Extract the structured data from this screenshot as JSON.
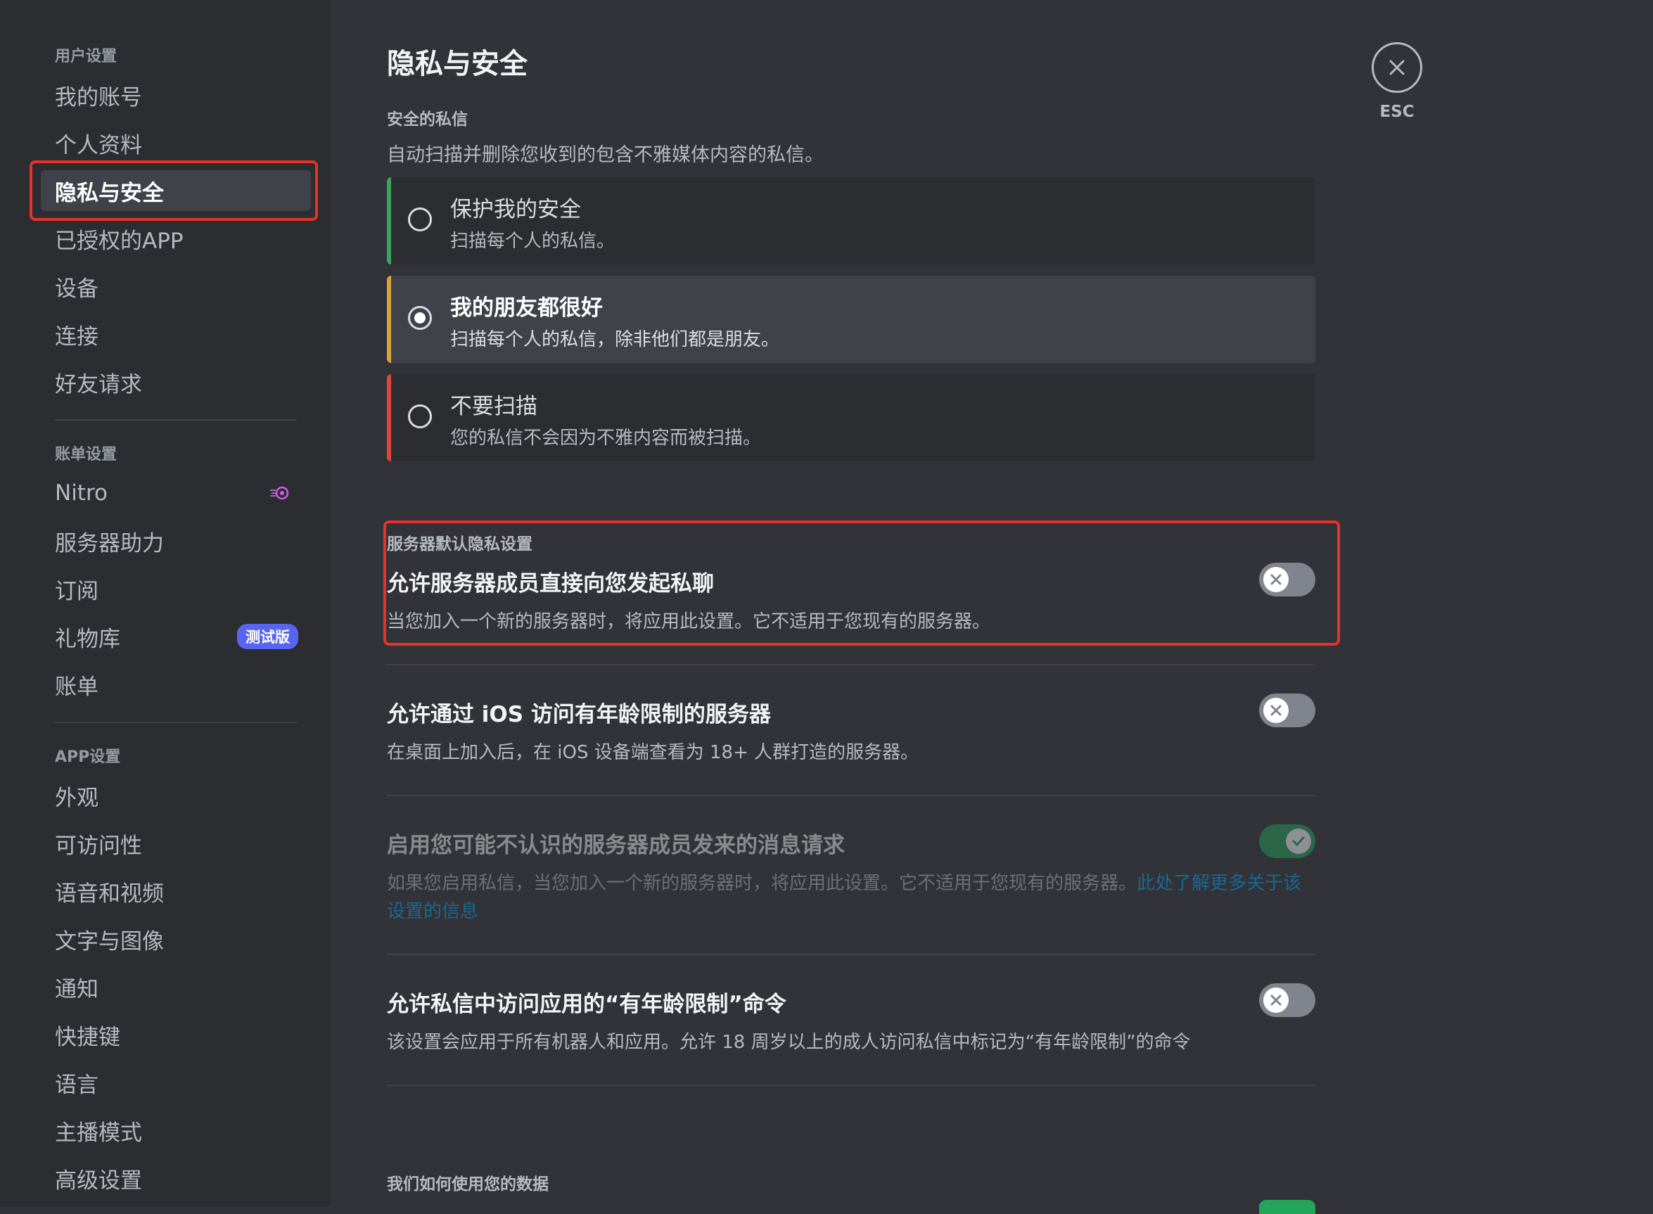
{
  "sidebar": {
    "user_settings_header": "用户设置",
    "user_items": [
      "我的账号",
      "个人资料",
      "隐私与安全",
      "已授权的APP",
      "设备",
      "连接",
      "好友请求"
    ],
    "billing_header": "账单设置",
    "billing_items": [
      "Nitro",
      "服务器助力",
      "订阅",
      "礼物库",
      "账单"
    ],
    "beta_badge": "测试版",
    "app_header": "APP设置",
    "app_items": [
      "外观",
      "可访问性",
      "语音和视频",
      "文字与图像",
      "通知",
      "快捷键",
      "语言",
      "主播模式",
      "高级设置"
    ],
    "selected_item": "隐私与安全"
  },
  "main": {
    "title": "隐私与安全",
    "safe_dm": {
      "header": "安全的私信",
      "description": "自动扫描并删除您收到的包含不雅媒体内容的私信。",
      "options": [
        {
          "title": "保护我的安全",
          "subtitle": "扫描每个人的私信。",
          "selected": false,
          "accent": "#3ba55c"
        },
        {
          "title": "我的朋友都很好",
          "subtitle": "扫描每个人的私信，除非他们都是朋友。",
          "selected": true,
          "accent": "#d9a43a"
        },
        {
          "title": "不要扫描",
          "subtitle": "您的私信不会因为不雅内容而被扫描。",
          "selected": false,
          "accent": "#e0453f"
        }
      ]
    },
    "server_privacy": {
      "header": "服务器默认隐私设置",
      "settings": [
        {
          "title": "允许服务器成员直接向您发起私聊",
          "description": "当您加入一个新的服务器时，将应用此设置。它不适用于您现有的服务器。",
          "enabled": false
        },
        {
          "title": "允许通过 iOS 访问有年龄限制的服务器",
          "description": "在桌面上加入后，在 iOS 设备端查看为 18+ 人群打造的服务器。",
          "enabled": false
        },
        {
          "title": "启用您可能不认识的服务器成员发来的消息请求",
          "description": "如果您启用私信，当您加入一个新的服务器时，将应用此设置。它不适用于您现有的服务器。",
          "link": "此处了解更多关于该设置的信息",
          "enabled": true,
          "disabled": true
        },
        {
          "title": "允许私信中访问应用的“有年龄限制”命令",
          "description": "该设置会应用于所有机器人和应用。允许 18 周岁以上的成人访问私信中标记为“有年龄限制”的命令",
          "enabled": false
        }
      ]
    },
    "data_header": "我们如何使用您的数据"
  },
  "close": {
    "label": "ESC"
  },
  "colors": {
    "accent_red_highlight": "#e5332a",
    "toggle_on": "#23a55a",
    "toggle_off": "#80848e",
    "link": "#00a8fc"
  }
}
